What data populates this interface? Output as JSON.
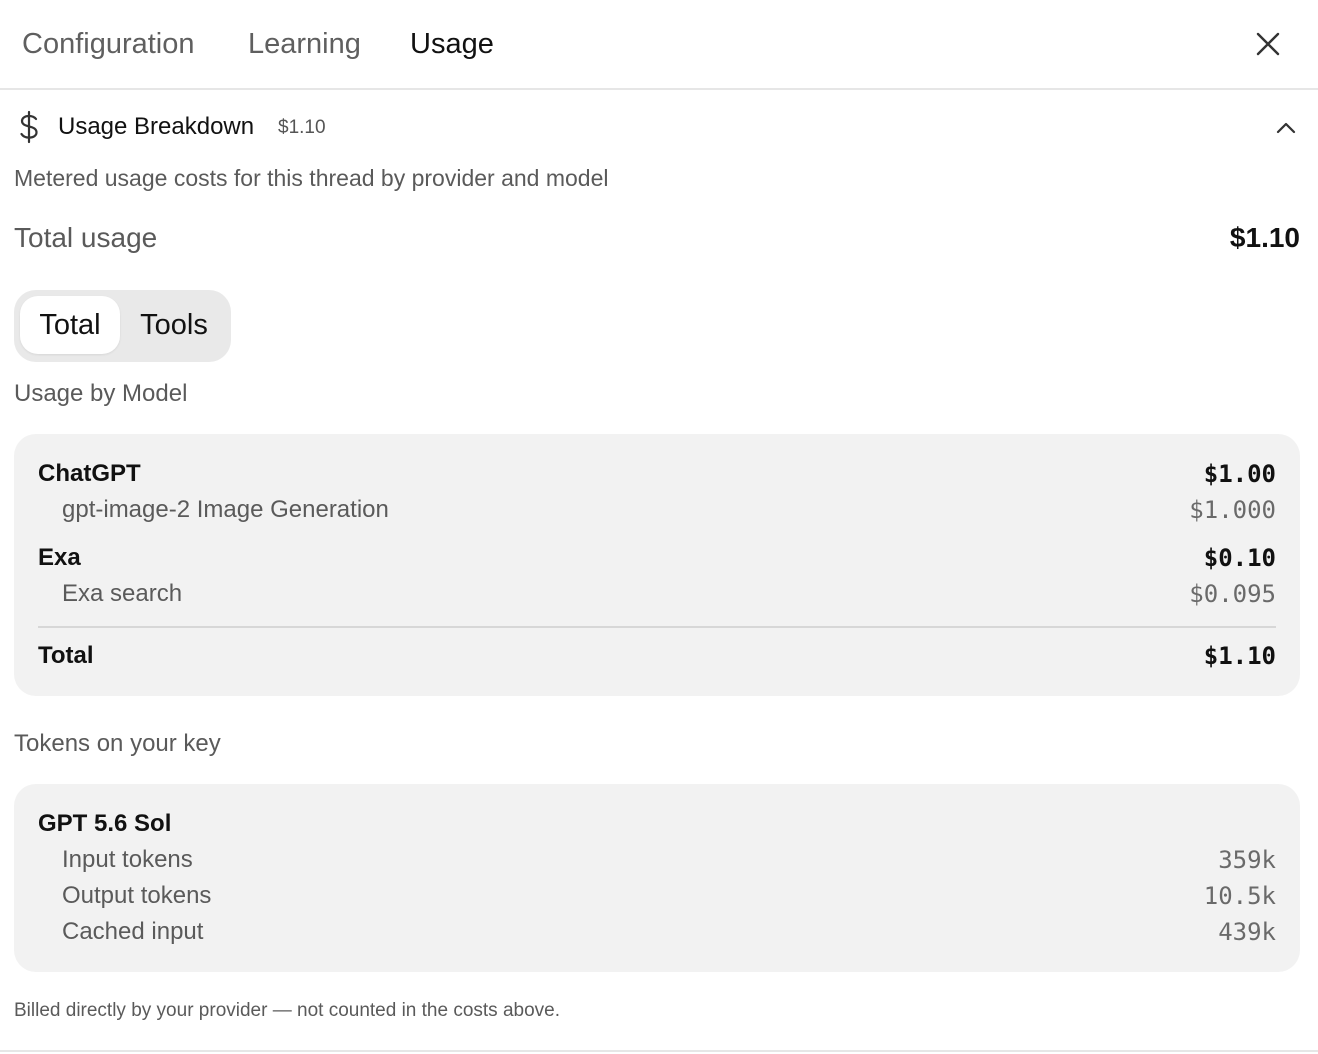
{
  "tabs": [
    {
      "label": "Configuration",
      "active": false
    },
    {
      "label": "Learning",
      "active": false
    },
    {
      "label": "Usage",
      "active": true
    }
  ],
  "icons": {
    "close": "close-icon",
    "dollar": "dollar-icon",
    "collapse": "chevron-up-icon"
  },
  "breakdown": {
    "title": "Usage Breakdown",
    "amount": "$1.10",
    "description": "Metered usage costs for this thread by provider and model",
    "total_label": "Total usage",
    "total_value": "$1.10"
  },
  "segmented": {
    "options": [
      "Total",
      "Tools"
    ],
    "selected": "Total"
  },
  "usage_by_model": {
    "heading": "Usage by Model",
    "providers": [
      {
        "name": "ChatGPT",
        "cost": "$1.00",
        "items": [
          {
            "name": "gpt-image-2 Image Generation",
            "cost": "$1.000"
          }
        ]
      },
      {
        "name": "Exa",
        "cost": "$0.10",
        "items": [
          {
            "name": "Exa search",
            "cost": "$0.095"
          }
        ]
      }
    ],
    "total_label": "Total",
    "total_value": "$1.10"
  },
  "tokens": {
    "heading": "Tokens on your key",
    "model": "GPT 5.6 Sol",
    "rows": [
      {
        "label": "Input tokens",
        "value": "359k"
      },
      {
        "label": "Output tokens",
        "value": "10.5k"
      },
      {
        "label": "Cached input",
        "value": "439k"
      }
    ]
  },
  "footnote": "Billed directly by your provider — not counted in the costs above.",
  "colors": {
    "card_bg": "#f2f2f2",
    "segment_bg": "#e9e9e9",
    "muted_text": "#5a5a5a"
  }
}
